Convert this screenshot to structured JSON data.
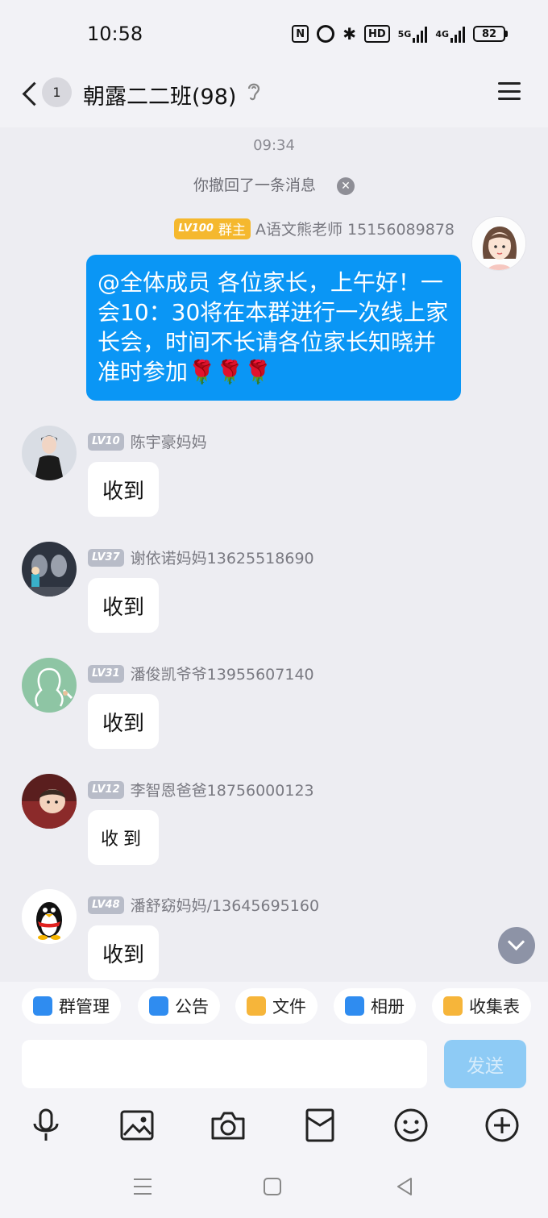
{
  "status": {
    "time": "10:58",
    "icons": [
      "nfc-icon",
      "alarm-icon",
      "bluetooth-icon",
      "hd-icon",
      "signal-5g-icon",
      "signal-4g-icon",
      "battery-icon"
    ],
    "hd": "HD",
    "net1": "5G",
    "net2": "4G",
    "battery": "82"
  },
  "header": {
    "unread": "1",
    "title": "朝露二二班(98)"
  },
  "chat": {
    "timestamp": "09:34",
    "recall_notice": "你撤回了一条消息",
    "owner": {
      "level": "LV100",
      "role": "群主",
      "name": "A语文熊老师 15156089878",
      "message": "@全体成员 各位家长，上午好！一会10：30将在本群进行一次线上家长会，时间不长请各位家长知晓并准时参加🌹🌹🌹"
    },
    "messages": [
      {
        "level": "LV10",
        "name": "陈宇豪妈妈",
        "text": "收到",
        "avatar": "woman-photo"
      },
      {
        "level": "LV37",
        "name": "谢依诺妈妈13625518690",
        "text": "收到",
        "avatar": "toy-figures-photo"
      },
      {
        "level": "LV31",
        "name": "潘俊凯爷爷13955607140",
        "text": "收到",
        "avatar": "default-silhouette"
      },
      {
        "level": "LV12",
        "name": "李智恩爸爸18756000123",
        "text": "收到",
        "avatar": "child-photo"
      },
      {
        "level": "LV48",
        "name": "潘舒窈妈妈/13645695160",
        "text": "收到",
        "avatar": "penguin"
      }
    ]
  },
  "quick_actions": [
    {
      "label": "群管理",
      "color": "#2f8cf0"
    },
    {
      "label": "公告",
      "color": "#2f8cf0"
    },
    {
      "label": "文件",
      "color": "#f6b53a"
    },
    {
      "label": "相册",
      "color": "#2f8cf0"
    },
    {
      "label": "收集表",
      "color": "#f6b53a"
    }
  ],
  "composer": {
    "placeholder": "",
    "send_label": "发送"
  },
  "toolbar": [
    "microphone-icon",
    "image-icon",
    "camera-icon",
    "red-packet-icon",
    "emoji-icon",
    "plus-icon"
  ],
  "nav": [
    "menu-nav-icon",
    "home-nav-icon",
    "back-nav-icon"
  ],
  "colors": {
    "accent": "#0a96f5",
    "background": "#ededf2",
    "owner_badge": "#f5b82e",
    "level_badge": "#b8bcc8"
  }
}
